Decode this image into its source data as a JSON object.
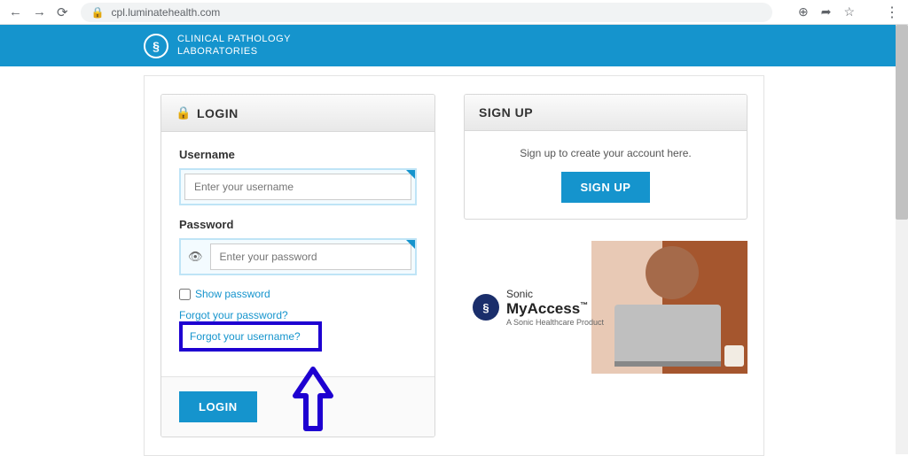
{
  "browser": {
    "url": "cpl.luminatehealth.com"
  },
  "brand": {
    "line1": "CLINICAL PATHOLOGY",
    "line2": "LABORATORIES"
  },
  "login": {
    "header": "LOGIN",
    "username_label": "Username",
    "username_placeholder": "Enter your username",
    "password_label": "Password",
    "password_placeholder": "Enter your password",
    "show_password_label": "Show password",
    "forgot_password": "Forgot your password?",
    "forgot_username": "Forgot your username?",
    "button": "LOGIN"
  },
  "signup": {
    "header": "SIGN UP",
    "text": "Sign up to create your account here.",
    "button": "SIGN UP"
  },
  "promo": {
    "line1": "Sonic",
    "line2": "MyAccess",
    "line3": "A Sonic Healthcare Product"
  }
}
